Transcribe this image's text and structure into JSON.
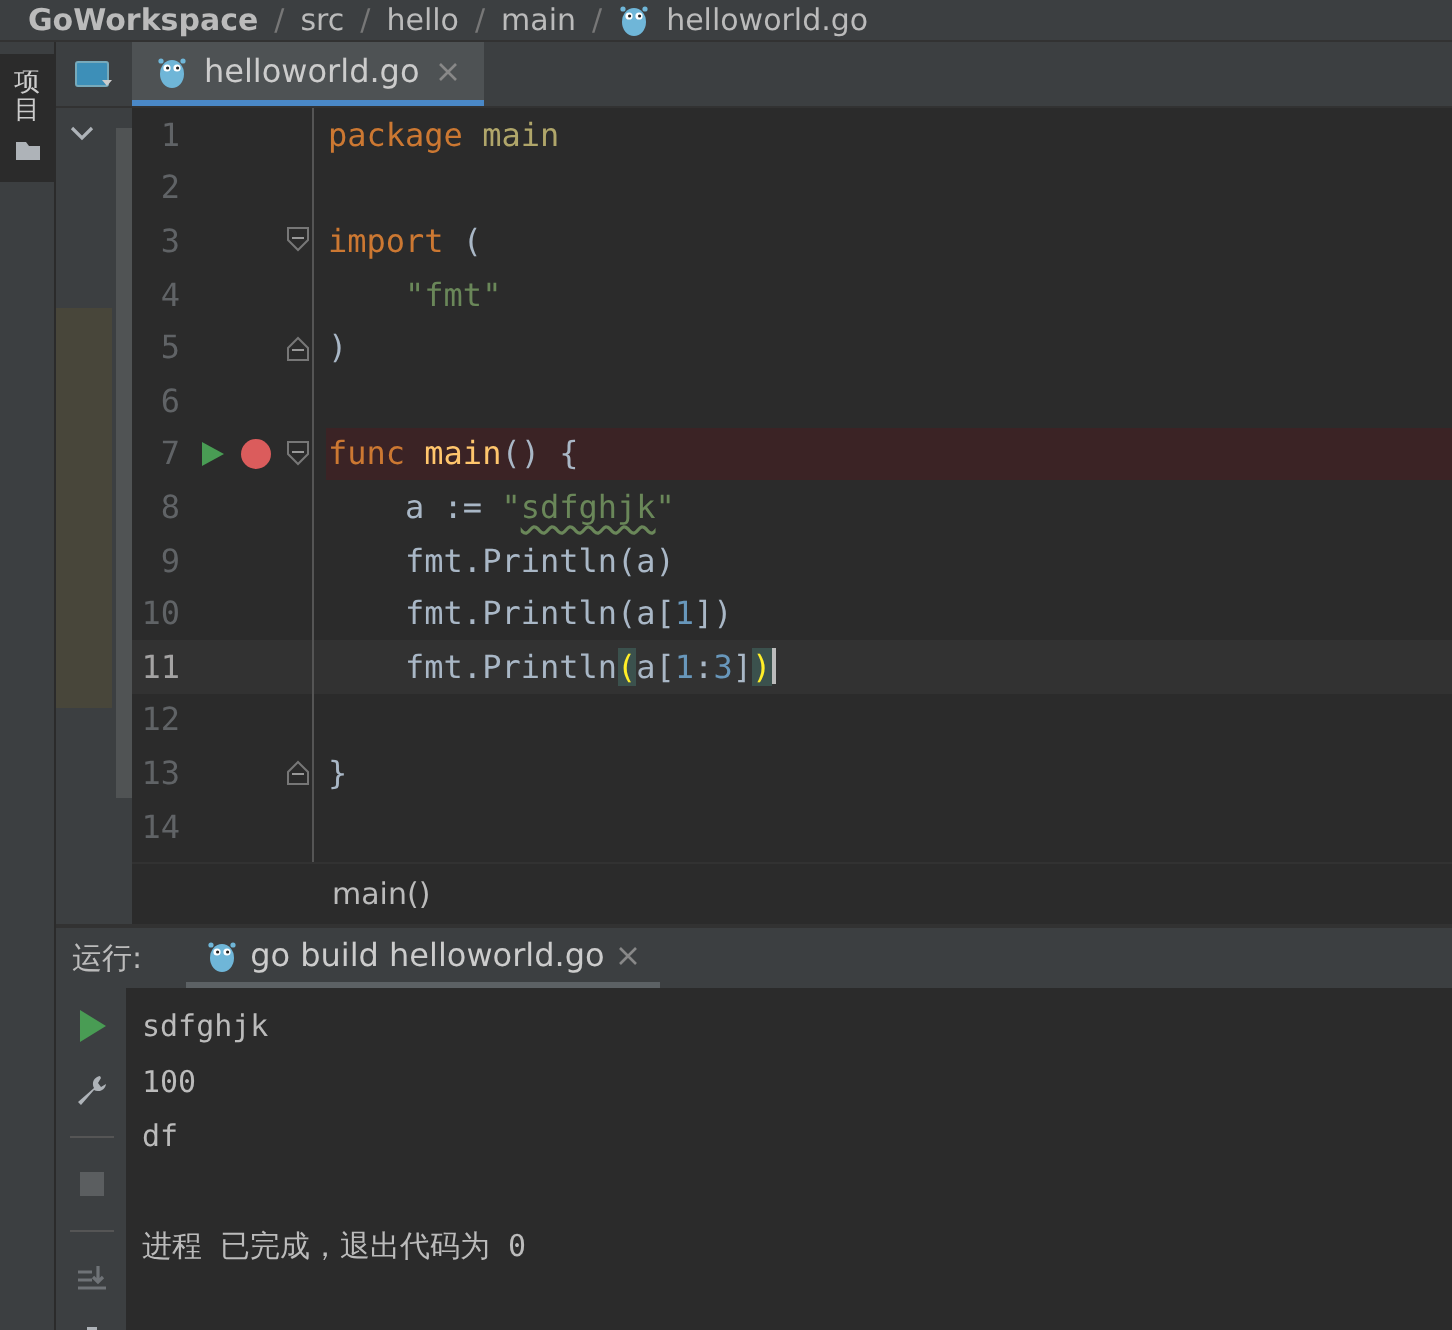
{
  "breadcrumb": [
    {
      "kind": "item",
      "text": "GoWorkspace"
    },
    {
      "kind": "separator",
      "text": "/"
    },
    {
      "kind": "item",
      "text": "src"
    },
    {
      "kind": "separator",
      "text": "/"
    },
    {
      "kind": "item",
      "text": "hello"
    },
    {
      "kind": "separator",
      "text": "/"
    },
    {
      "kind": "item",
      "text": "main"
    },
    {
      "kind": "separator",
      "text": "/"
    },
    {
      "kind": "file",
      "text": "helloworld.go"
    }
  ],
  "side_strip": {
    "label": "项目"
  },
  "editor_tabs": [
    {
      "label": "helloworld.go",
      "selected": true
    }
  ],
  "code_lines": [
    {
      "number": "1",
      "run_marker": false,
      "breakpoint": false,
      "current": false,
      "fold_start": false,
      "fold_end": false,
      "tokens": [
        {
          "kind": "keyword",
          "text": "package"
        },
        {
          "kind": "package",
          "text": " main"
        }
      ]
    },
    {
      "number": "2",
      "run_marker": false,
      "breakpoint": false,
      "current": false,
      "fold_start": false,
      "fold_end": false
    },
    {
      "number": "3",
      "run_marker": false,
      "breakpoint": false,
      "current": false,
      "fold_start": true,
      "fold_end": false,
      "tokens": [
        {
          "kind": "keyword",
          "text": "import"
        },
        {
          "kind": "plain",
          "text": " ("
        }
      ]
    },
    {
      "number": "4",
      "run_marker": false,
      "breakpoint": false,
      "current": false,
      "fold_start": false,
      "fold_end": false,
      "tokens": [
        {
          "kind": "string",
          "text": "    \"fmt\""
        }
      ]
    },
    {
      "number": "5",
      "run_marker": false,
      "breakpoint": false,
      "current": false,
      "fold_start": false,
      "fold_end": true,
      "tokens": [
        {
          "kind": "plain",
          "text": ")"
        }
      ]
    },
    {
      "number": "6",
      "run_marker": false,
      "breakpoint": false,
      "current": false,
      "fold_start": false,
      "fold_end": false
    },
    {
      "number": "7",
      "run_marker": true,
      "breakpoint": true,
      "current": false,
      "fold_start": true,
      "fold_end": false,
      "tokens": [
        {
          "kind": "keyword",
          "text": "func"
        },
        {
          "kind": "function",
          "text": " main"
        },
        {
          "kind": "plain",
          "text": "() {"
        }
      ]
    },
    {
      "number": "8",
      "run_marker": false,
      "breakpoint": false,
      "current": false,
      "fold_start": false,
      "fold_end": false,
      "tokens": [
        {
          "kind": "plain",
          "text": "    a := "
        },
        {
          "kind": "string",
          "text": "\""
        },
        {
          "kind": "string-typo",
          "text": "sdfghjk"
        },
        {
          "kind": "string",
          "text": "\""
        }
      ]
    },
    {
      "number": "9",
      "run_marker": false,
      "breakpoint": false,
      "current": false,
      "fold_start": false,
      "fold_end": false,
      "tokens": [
        {
          "kind": "plain",
          "text": "    fmt.Println(a)"
        }
      ]
    },
    {
      "number": "10",
      "run_marker": false,
      "breakpoint": false,
      "current": false,
      "fold_start": false,
      "fold_end": false,
      "tokens": [
        {
          "kind": "plain",
          "text": "    fmt.Println(a["
        },
        {
          "kind": "number",
          "text": "1"
        },
        {
          "kind": "plain",
          "text": "])"
        }
      ]
    },
    {
      "number": "11",
      "run_marker": false,
      "breakpoint": false,
      "current": true,
      "fold_start": false,
      "fold_end": false,
      "tokens": [
        {
          "kind": "plain",
          "text": "    fmt.Println"
        },
        {
          "kind": "brace-match",
          "text": "("
        },
        {
          "kind": "plain",
          "text": "a["
        },
        {
          "kind": "number",
          "text": "1"
        },
        {
          "kind": "plain",
          "text": ":"
        },
        {
          "kind": "number",
          "text": "3"
        },
        {
          "kind": "plain",
          "text": "]"
        },
        {
          "kind": "brace-match",
          "text": ")"
        }
      ]
    },
    {
      "number": "12",
      "run_marker": false,
      "breakpoint": false,
      "current": false,
      "fold_start": false,
      "fold_end": false
    },
    {
      "number": "13",
      "run_marker": false,
      "breakpoint": false,
      "current": false,
      "fold_start": false,
      "fold_end": true,
      "tokens": [
        {
          "kind": "plain",
          "text": "}"
        }
      ]
    },
    {
      "number": "14",
      "run_marker": false,
      "breakpoint": false,
      "current": false,
      "fold_start": false,
      "fold_end": false
    }
  ],
  "editor_breadcrumb": "main()",
  "run_panel": {
    "label": "运行:",
    "tabs": [
      {
        "label": "go build helloworld.go",
        "selected": true
      }
    ],
    "output": [
      "sdfghjk",
      "100",
      "df"
    ],
    "exit_message": "进程 已完成，退出代码为 0"
  }
}
